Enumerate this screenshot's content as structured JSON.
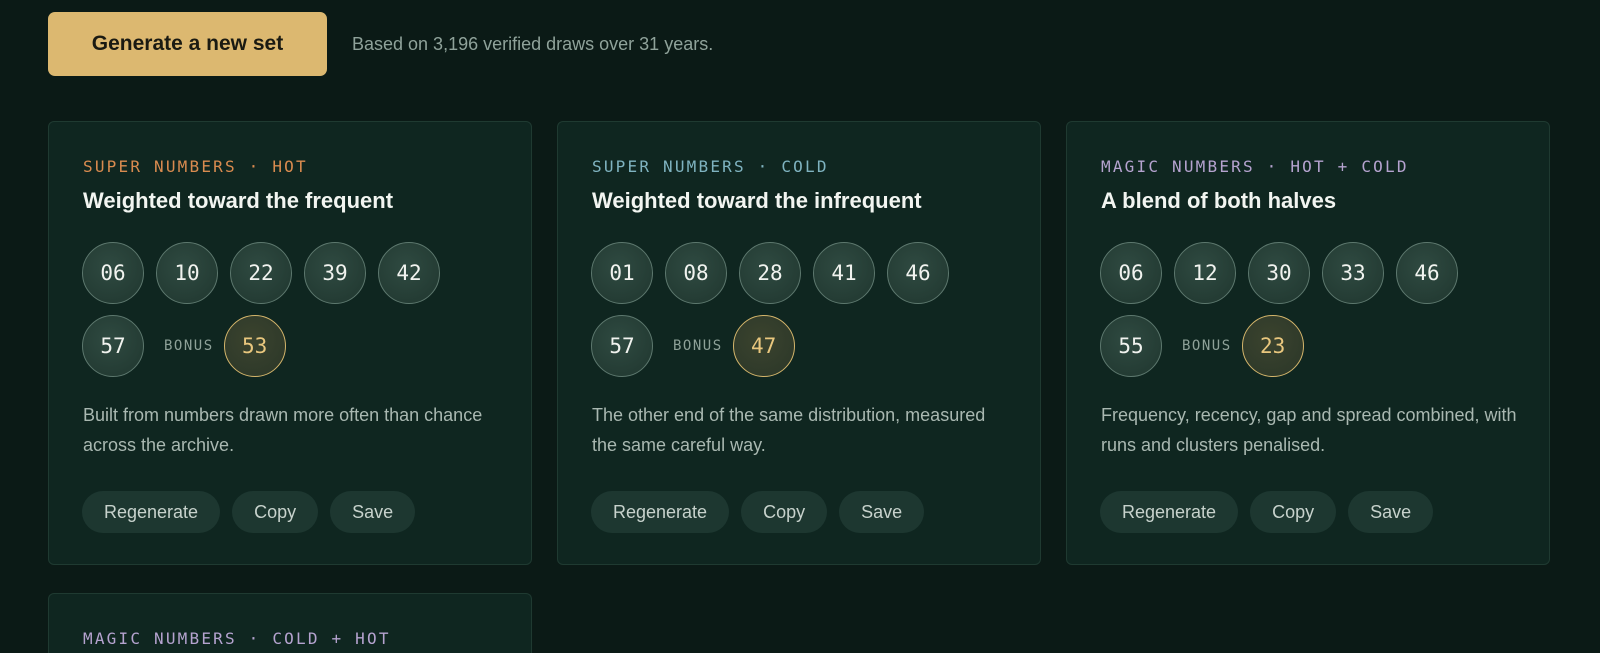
{
  "header": {
    "generate_label": "Generate a new set",
    "note": "Based on 3,196 verified draws over 31 years."
  },
  "cards": [
    {
      "eyebrow": "SUPER NUMBERS · HOT",
      "eyebrow_color": "#d98b4f",
      "title": "Weighted toward the frequent",
      "numbers": [
        "06",
        "10",
        "22",
        "39",
        "42",
        "57"
      ],
      "bonus_label": "BONUS",
      "bonus": "53",
      "description": "Built from numbers drawn more often than chance across the archive.",
      "actions": [
        "Regenerate",
        "Copy",
        "Save"
      ]
    },
    {
      "eyebrow": "SUPER NUMBERS · COLD",
      "eyebrow_color": "#7fb3c0",
      "title": "Weighted toward the infrequent",
      "numbers": [
        "01",
        "08",
        "28",
        "41",
        "46",
        "57"
      ],
      "bonus_label": "BONUS",
      "bonus": "47",
      "description": "The other end of the same distribution, measured the same careful way.",
      "actions": [
        "Regenerate",
        "Copy",
        "Save"
      ]
    },
    {
      "eyebrow": "MAGIC NUMBERS · HOT + COLD",
      "eyebrow_color": "#b5a3cf",
      "title": "A blend of both halves",
      "numbers": [
        "06",
        "12",
        "30",
        "33",
        "46",
        "55"
      ],
      "bonus_label": "BONUS",
      "bonus": "23",
      "description": "Frequency, recency, gap and spread combined, with runs and clusters penalised.",
      "actions": [
        "Regenerate",
        "Copy",
        "Save"
      ]
    },
    {
      "eyebrow": "MAGIC NUMBERS · COLD + HOT",
      "eyebrow_color": "#b5a3cf"
    }
  ]
}
